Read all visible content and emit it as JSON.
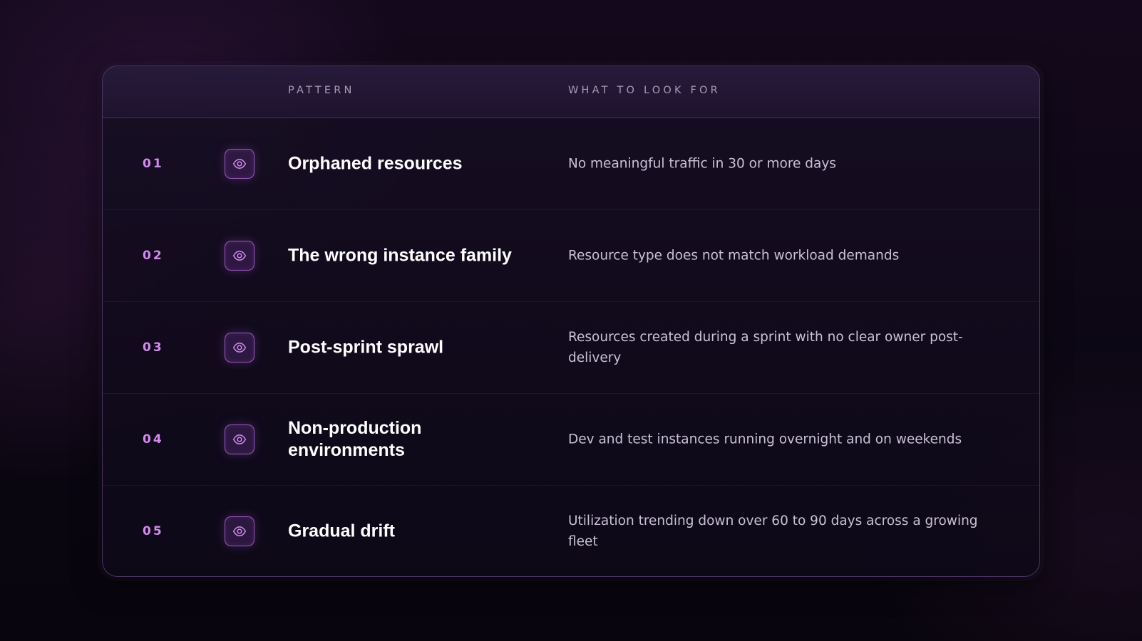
{
  "table": {
    "headers": {
      "pattern": "PATTERN",
      "look_for": "WHAT TO LOOK FOR"
    },
    "icon": "eye-icon",
    "accent_color": "#d58af0",
    "rows": [
      {
        "number": "01",
        "pattern": "Orphaned resources",
        "look_for": "No meaningful traffic in 30 or more days"
      },
      {
        "number": "02",
        "pattern": "The wrong instance family",
        "look_for": "Resource type does not match workload demands"
      },
      {
        "number": "03",
        "pattern": "Post-sprint sprawl",
        "look_for": "Resources created during a sprint with no clear owner post-delivery"
      },
      {
        "number": "04",
        "pattern": "Non-production environments",
        "look_for": "Dev and test instances running overnight and on weekends"
      },
      {
        "number": "05",
        "pattern": "Gradual drift",
        "look_for": "Utilization trending down over 60 to 90 days across a growing fleet"
      }
    ]
  }
}
